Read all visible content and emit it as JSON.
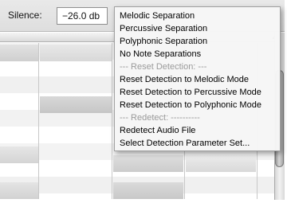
{
  "toolbar": {
    "silence_label": "Silence:",
    "silence_value": "−26.0 db"
  },
  "menu": {
    "items": [
      {
        "label": "Melodic Separation",
        "type": "item"
      },
      {
        "label": "Percussive Separation",
        "type": "item"
      },
      {
        "label": "Polyphonic Separation",
        "type": "item"
      },
      {
        "label": "No Note Separations",
        "type": "item"
      },
      {
        "label": "--- Reset Detection: ---",
        "type": "separator"
      },
      {
        "label": "Reset Detection to Melodic Mode",
        "type": "item"
      },
      {
        "label": "Reset Detection to Percussive Mode",
        "type": "item"
      },
      {
        "label": "Reset Detection to Polyphonic Mode",
        "type": "item"
      },
      {
        "label": "--- Redetect: ----------",
        "type": "separator"
      },
      {
        "label": "Redetect Audio File",
        "type": "item"
      },
      {
        "label": "Select Detection Parameter Set...",
        "type": "item"
      }
    ]
  },
  "colors": {
    "grid_line": "#c8c8c8",
    "menu_bg": "#f6f6f6",
    "separator_text": "#9a9a9a"
  }
}
